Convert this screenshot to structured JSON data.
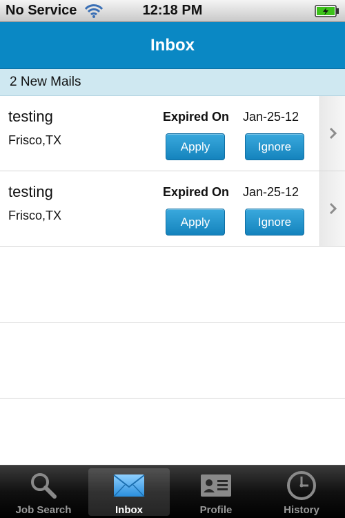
{
  "status_bar": {
    "carrier": "No Service",
    "time": "12:18 PM",
    "battery_color": "#3cc21a"
  },
  "nav": {
    "title": "Inbox",
    "color": "#0a88c4"
  },
  "section": {
    "label": "2 New Mails"
  },
  "mails": [
    {
      "title": "testing",
      "location": "Frisco,TX",
      "expired_label": "Expired On",
      "expired_date": "Jan-25-12",
      "apply_label": "Apply",
      "ignore_label": "Ignore"
    },
    {
      "title": "testing",
      "location": "Frisco,TX",
      "expired_label": "Expired On",
      "expired_date": "Jan-25-12",
      "apply_label": "Apply",
      "ignore_label": "Ignore"
    }
  ],
  "tabs": [
    {
      "label": "Job Search",
      "icon": "search-icon",
      "active": false
    },
    {
      "label": "Inbox",
      "icon": "envelope-icon",
      "active": true
    },
    {
      "label": "Profile",
      "icon": "profile-card-icon",
      "active": false
    },
    {
      "label": "History",
      "icon": "clock-icon",
      "active": false
    }
  ]
}
